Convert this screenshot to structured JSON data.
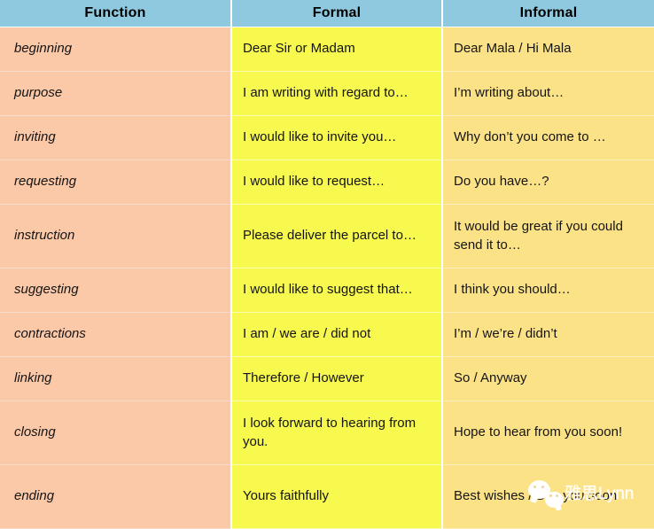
{
  "colors": {
    "header_bg": "#8fc9df",
    "function_bg": "#fcc9a8",
    "formal_bg": "#f7f94e",
    "informal_bg": "#fce286",
    "text": "#141414",
    "grid": "#ffffff"
  },
  "table": {
    "headers": [
      {
        "label": "Function"
      },
      {
        "label": "Formal"
      },
      {
        "label": "Informal"
      }
    ],
    "rows": [
      {
        "function": "beginning",
        "formal": "Dear Sir or Madam",
        "informal": "Dear Mala / Hi Mala",
        "tall": false
      },
      {
        "function": "purpose",
        "formal": "I am writing with regard to…",
        "informal": "I’m writing about…",
        "tall": false
      },
      {
        "function": "inviting",
        "formal": "I would like to invite you…",
        "informal": "Why don’t you come to …",
        "tall": false
      },
      {
        "function": "requesting",
        "formal": "I would like to request…",
        "informal": "Do you have…?",
        "tall": false
      },
      {
        "function": "instruction",
        "formal": "Please deliver the parcel to…",
        "informal": "It would be great if you could send it to…",
        "tall": true
      },
      {
        "function": "suggesting",
        "formal": "I would like to suggest that…",
        "informal": "I think you should…",
        "tall": false
      },
      {
        "function": "contractions",
        "formal": "I am / we are / did not",
        "informal": "I’m / we’re / didn’t",
        "tall": false
      },
      {
        "function": "linking",
        "formal": "Therefore / However",
        "informal": "So / Anyway",
        "tall": false
      },
      {
        "function": "closing",
        "formal": "I look forward to hearing from you.",
        "informal": "Hope to hear from you soon!",
        "tall": true
      },
      {
        "function": "ending",
        "formal": "Yours faithfully",
        "informal": "Best wishes / See you soon",
        "tall": true
      }
    ]
  },
  "watermark": {
    "text": "雅思Lynn",
    "icon": "wechat-icon"
  }
}
